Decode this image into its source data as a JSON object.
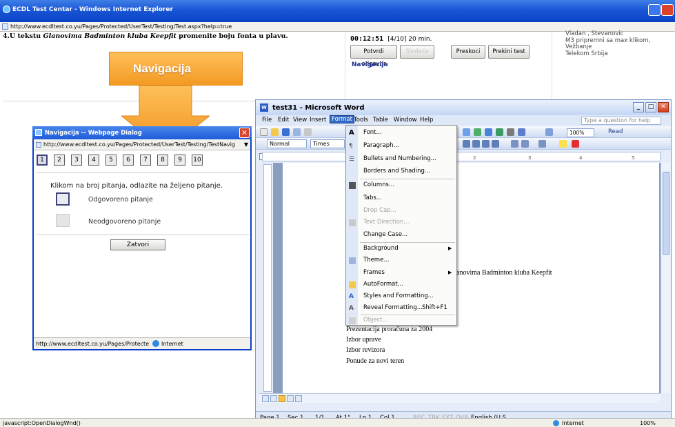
{
  "ie": {
    "title": "ECDL Test Centar - Windows Internet Explorer",
    "url": "http://www.ecdltest.co.yu/Pages/Protected/UserTest/Testing/Test.aspx?help=true",
    "status_text": "javascript:OpenDialogWnd()",
    "status_zone": "Internet",
    "status_zoom": "100%"
  },
  "test": {
    "question_prefix": "4.U tekstu ",
    "question_italic": "Glanovima Badminton kluba Keepfit",
    "question_suffix": " promenite boju fonta u plavu.",
    "timer": "00:12:51",
    "timer_rest": "[4/10] 20 min.",
    "buttons": {
      "confirm": "Potvrdi odgovor",
      "next": "Sledeće",
      "skip": "Preskoci",
      "abort": "Prekini test"
    },
    "nav_link": "Navigacija",
    "user": {
      "name": "Vladan , Stevanovic",
      "line2": "M3 pripremni sa max klikom,",
      "line3": "Vežbanje",
      "line4": "Telekom Srbija"
    }
  },
  "callout": {
    "label": "Navigacija",
    "fill_color": "#f5a431"
  },
  "nav_dialog": {
    "title": "Navigacija -- Webpage Dialog",
    "url": "http://www.ecdltest.co.yu/Pages/Protected/UserTest/Testing/TestNavig",
    "questions": [
      "1",
      "2",
      "3",
      "4",
      "5",
      "6",
      "7",
      "8",
      "9",
      "10"
    ],
    "instruction": "Klikom na broj pitanja, odlazite na željeno pitanje.",
    "legend_answered": "Odgovoreno pitanje",
    "legend_unanswered": "Neodgovoreno pitanje",
    "close_label": "Zatvori",
    "status_url": "http://www.ecdltest.co.yu/Pages/Protecte",
    "status_zone": "Internet"
  },
  "word": {
    "title": "test31      - Microsoft Word",
    "menus": [
      "File",
      "Edit",
      "View",
      "Insert",
      "Format",
      "Tools",
      "Table",
      "Window",
      "Help"
    ],
    "help_placeholder": "Type a question for help",
    "style": "Normal",
    "font": "Times",
    "zoom": "100%",
    "read": "Read",
    "ruler_ticks": [
      "1",
      "2",
      "3",
      "4",
      "5"
    ],
    "doc_lines": {
      "partial": "anovima Badminton kluba Keepfit",
      "l1": "Prezentacija proračuna za 2004",
      "l2": "Izbor uprave",
      "l3": "Izbor revizora",
      "l4": "Ponude za novi teren"
    },
    "status": {
      "page": "Page 1",
      "sec": "Sec 1",
      "pages": "1/1",
      "at": "At 1\"",
      "ln": "Ln 1",
      "col": "Col 1",
      "rec": "REC",
      "trk": "TRK",
      "ext": "EXT",
      "ovr": "OVR",
      "lang": "English (U.S"
    }
  },
  "format_menu": {
    "font": "Font...",
    "paragraph": "Paragraph...",
    "bullets": "Bullets and Numbering...",
    "borders": "Borders and Shading...",
    "columns": "Columns...",
    "tabs": "Tabs...",
    "drop_cap": "Drop Cap...",
    "text_direction": "Text Direction...",
    "change_case": "Change Case...",
    "background": "Background",
    "theme": "Theme...",
    "frames": "Frames",
    "autoformat": "AutoFormat...",
    "styles": "Styles and Formatting...",
    "reveal": "Reveal Formatting...",
    "reveal_shortcut": "Shift+F1",
    "object": "Object..."
  }
}
